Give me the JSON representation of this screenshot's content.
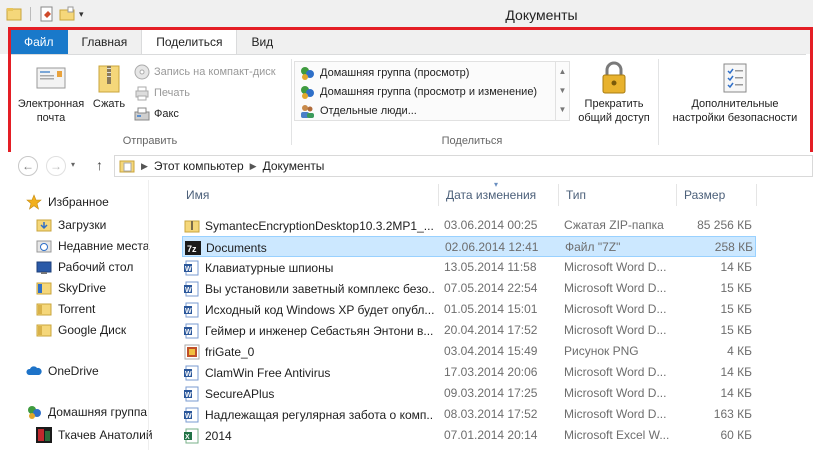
{
  "window": {
    "title": "Документы"
  },
  "ribbon": {
    "tabs": [
      {
        "label": "Файл"
      },
      {
        "label": "Главная"
      },
      {
        "label": "Поделиться"
      },
      {
        "label": "Вид"
      }
    ],
    "send_group": {
      "label": "Отправить",
      "email_label": "Электронная почта",
      "zip_label": "Сжать",
      "burn_label": "Запись на компакт-диск",
      "print_label": "Печать",
      "fax_label": "Факс"
    },
    "share_group": {
      "label": "Поделиться",
      "gallery": [
        {
          "label": "Домашняя группа (просмотр)"
        },
        {
          "label": "Домашняя группа (просмотр и изменение)"
        },
        {
          "label": "Отдельные люди..."
        }
      ],
      "stop_sharing_label": "Прекратить общий доступ"
    },
    "advanced_security_label": "Дополнительные настройки безопасности"
  },
  "address": {
    "crumbs": [
      {
        "label": "Этот компьютер"
      },
      {
        "label": "Документы"
      }
    ]
  },
  "navigation": {
    "items": [
      {
        "label": "Избранное",
        "icon": "star-icon"
      },
      {
        "label": "Загрузки",
        "icon": "downloads-folder-icon"
      },
      {
        "label": "Недавние места",
        "icon": "recent-places-icon"
      },
      {
        "label": "Рабочий стол",
        "icon": "desktop-icon"
      },
      {
        "label": "SkyDrive",
        "icon": "skydrive-folder-icon"
      },
      {
        "label": "Torrent",
        "icon": "folder-icon"
      },
      {
        "label": "Google Диск",
        "icon": "google-drive-folder-icon"
      },
      {
        "label": "OneDrive",
        "icon": "onedrive-cloud-icon"
      },
      {
        "label": "Домашняя группа",
        "icon": "homegroup-icon"
      },
      {
        "label": "Ткачев Анатолий",
        "icon": "user-avatar-icon"
      }
    ]
  },
  "file_list": {
    "columns": {
      "name": "Имя",
      "date": "Дата изменения",
      "type": "Тип",
      "size": "Размер"
    },
    "rows": [
      {
        "name": "SymantecEncryptionDesktop10.3.2MP1_...",
        "date": "03.06.2014 00:25",
        "type": "Сжатая ZIP-папка",
        "size": "85 256 КБ",
        "icon": "zip-folder-icon"
      },
      {
        "name": "Documents",
        "date": "02.06.2014 12:41",
        "type": "Файл \"7Z\"",
        "size": "258 КБ",
        "icon": "7z-archive-icon"
      },
      {
        "name": "Клавиатурные шпионы",
        "date": "13.05.2014 11:58",
        "type": "Microsoft Word D...",
        "size": "14 КБ",
        "icon": "word-document-icon"
      },
      {
        "name": "Вы установили заветный комплекс безо...",
        "date": "07.05.2014 22:54",
        "type": "Microsoft Word D...",
        "size": "15 КБ",
        "icon": "word-document-icon"
      },
      {
        "name": "Исходный код Windows XP будет опубл...",
        "date": "01.05.2014 15:01",
        "type": "Microsoft Word D...",
        "size": "15 КБ",
        "icon": "word-document-icon"
      },
      {
        "name": "Геймер и инженер Себастьян Энтони в...",
        "date": "20.04.2014 17:52",
        "type": "Microsoft Word D...",
        "size": "15 КБ",
        "icon": "word-document-icon"
      },
      {
        "name": "friGate_0",
        "date": "03.04.2014 15:49",
        "type": "Рисунок PNG",
        "size": "4 КБ",
        "icon": "png-image-icon"
      },
      {
        "name": "ClamWin Free Antivirus",
        "date": "17.03.2014 20:06",
        "type": "Microsoft Word D...",
        "size": "14 КБ",
        "icon": "word-document-icon"
      },
      {
        "name": "SecureAPlus",
        "date": "09.03.2014 17:25",
        "type": "Microsoft Word D...",
        "size": "14 КБ",
        "icon": "word-document-icon"
      },
      {
        "name": "Надлежащая регулярная забота о комп...",
        "date": "08.03.2014 17:52",
        "type": "Microsoft Word D...",
        "size": "163 КБ",
        "icon": "word-document-icon"
      },
      {
        "name": "2014",
        "date": "07.01.2014 20:14",
        "type": "Microsoft Excel W...",
        "size": "60 КБ",
        "icon": "excel-workbook-icon"
      }
    ]
  },
  "colors": {
    "file_tab": "#1979ca",
    "highlight_frame": "#e41e25",
    "selection": "#cce8ff"
  }
}
